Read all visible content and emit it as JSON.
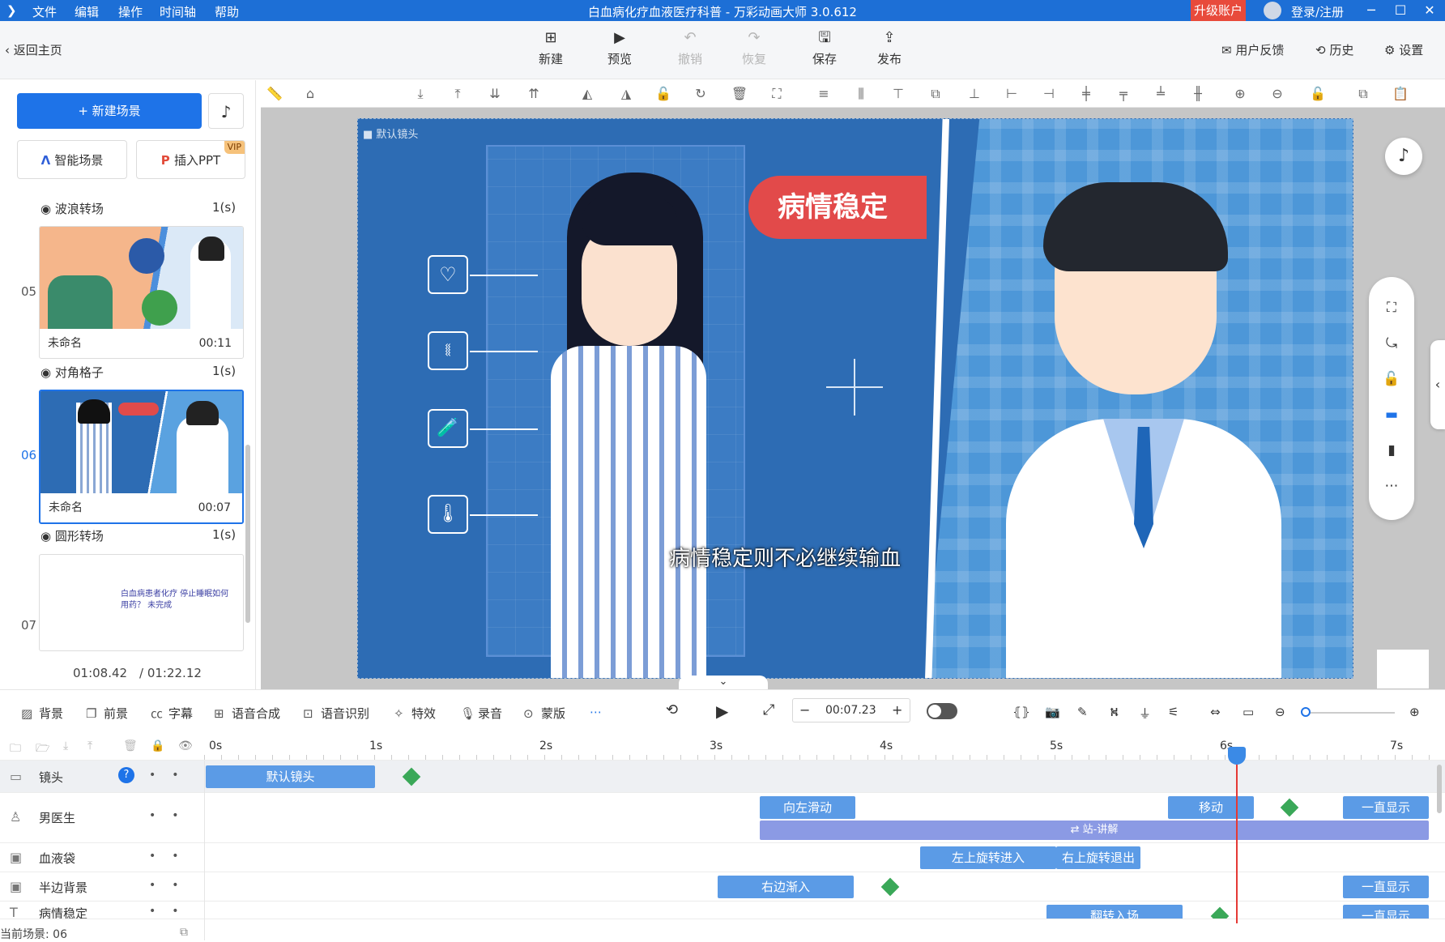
{
  "titlebar": {
    "menus": [
      "文件",
      "编辑",
      "操作",
      "时间轴",
      "帮助"
    ],
    "title": "白血病化疗血液医疗科普 - 万彩动画大师 3.0.612",
    "upgrade": "升级账户",
    "login": "登录/注册"
  },
  "toolbar": {
    "back": "返回主页",
    "new": "新建",
    "preview": "预览",
    "undo": "撤销",
    "redo": "恢复",
    "save": "保存",
    "publish": "发布",
    "feedback": "用户反馈",
    "history": "历史",
    "settings": "设置"
  },
  "left": {
    "new_scene": "+ 新建场景",
    "smart_scene": "智能场景",
    "insert_ppt": "插入PPT",
    "vip": "VIP",
    "scenes": [
      {
        "transition": "波浪转场",
        "tdur": "1(s)",
        "num": "05",
        "name": "未命名",
        "time": "00:11"
      },
      {
        "transition": "对角格子",
        "tdur": "1(s)",
        "num": "06",
        "name": "未命名",
        "time": "00:07"
      },
      {
        "transition": "圆形转场",
        "tdur": "1(s)",
        "num": "07",
        "name": "",
        "time": ""
      }
    ],
    "thumb7_text": "白血病患者化疗 停止睡眠如何用药？ 未完成",
    "current_time": "01:08.42",
    "total_time": "/ 01:22.12"
  },
  "canvas": {
    "camera_label": "默认镜头",
    "badge_text": "病情稳定",
    "subtitle": "病情稳定则不必继续输血"
  },
  "bottom_toolbar": {
    "items": [
      "背景",
      "前景",
      "字幕",
      "语音合成",
      "语音识别",
      "特效",
      "录音",
      "蒙版"
    ],
    "time": "00:07.23"
  },
  "timeline": {
    "ticks": [
      "0s",
      "1s",
      "2s",
      "3s",
      "4s",
      "5s",
      "6s",
      "7s"
    ],
    "rows": [
      {
        "name": "镜头"
      },
      {
        "name": "男医生"
      },
      {
        "name": "血液袋"
      },
      {
        "name": "半边背景"
      },
      {
        "name": "病情稳定"
      }
    ],
    "clips": {
      "camera_default": "默认镜头",
      "slide_left": "向左滑动",
      "move": "移动",
      "always_show": "一直显示",
      "stand_explain": "⇄ 站-讲解",
      "rotate_in": "左上旋转进入",
      "rotate_out": "右上旋转退出",
      "right_fade": "右边渐入",
      "always_show2": "一直显示",
      "flip_in": "翻转入场",
      "always_show3": "一直显示"
    },
    "status": "当前场景: 06"
  },
  "colors": {
    "accent": "#1d6fd6",
    "upgrade": "#e84a3b",
    "clip": "#5b9be6",
    "playhead": "#e53935"
  }
}
